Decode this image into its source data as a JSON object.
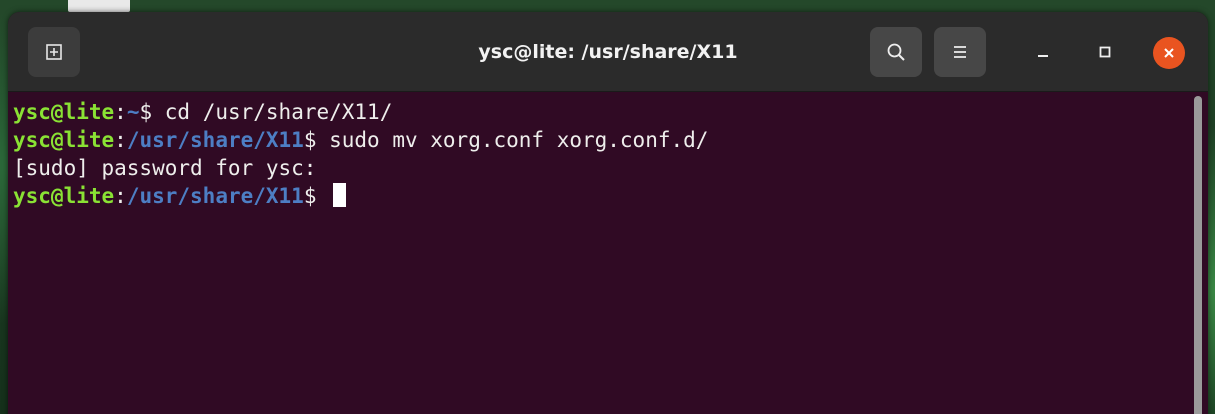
{
  "window": {
    "title": "ysc@lite: /usr/share/X11"
  },
  "icons": {
    "new_tab": "new-tab-icon",
    "search": "search-icon",
    "menu": "hamburger-menu-icon",
    "minimize": "minimize-icon",
    "maximize": "maximize-icon",
    "close": "close-icon"
  },
  "colors": {
    "terminal_bg": "#300a24",
    "prompt_user": "#8ae234",
    "prompt_path": "#4d7ec4",
    "text": "#eeeeec",
    "close_button": "#e95420",
    "titlebar": "#2b2b2b"
  },
  "terminal": {
    "lines": [
      {
        "user": "ysc@lite",
        "sep": ":",
        "path": "~",
        "dollar": "$ ",
        "text": "cd /usr/share/X11/"
      },
      {
        "user": "ysc@lite",
        "sep": ":",
        "path": "/usr/share/X11",
        "dollar": "$ ",
        "text": "sudo mv xorg.conf xorg.conf.d/"
      },
      {
        "output": "[sudo] password for ysc:"
      },
      {
        "user": "ysc@lite",
        "sep": ":",
        "path": "/usr/share/X11",
        "dollar": "$ ",
        "text": ""
      }
    ]
  }
}
